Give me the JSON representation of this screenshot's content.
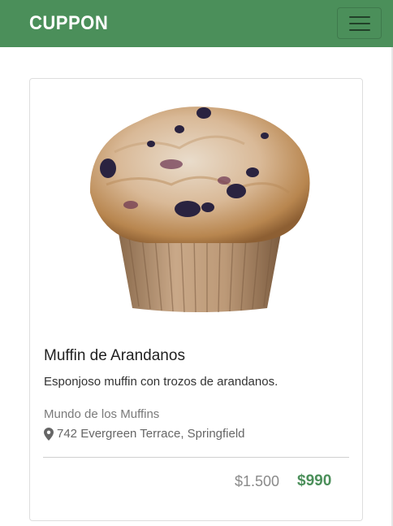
{
  "navbar": {
    "brand": "CUPPON",
    "menu_icon": "hamburger-menu-icon",
    "color": "#4b8f5a"
  },
  "card": {
    "image_alt": "Muffin de Arandanos",
    "title": "Muffin de Arandanos",
    "description": "Esponjoso muffin con trozos de arandanos.",
    "store": "Mundo de los Muffins",
    "address_icon": "map-marker-icon",
    "address": "742 Evergreen Terrace, Springfield",
    "old_price": "$1.500",
    "new_price": "$990",
    "accent_color": "#4b8f5a"
  }
}
